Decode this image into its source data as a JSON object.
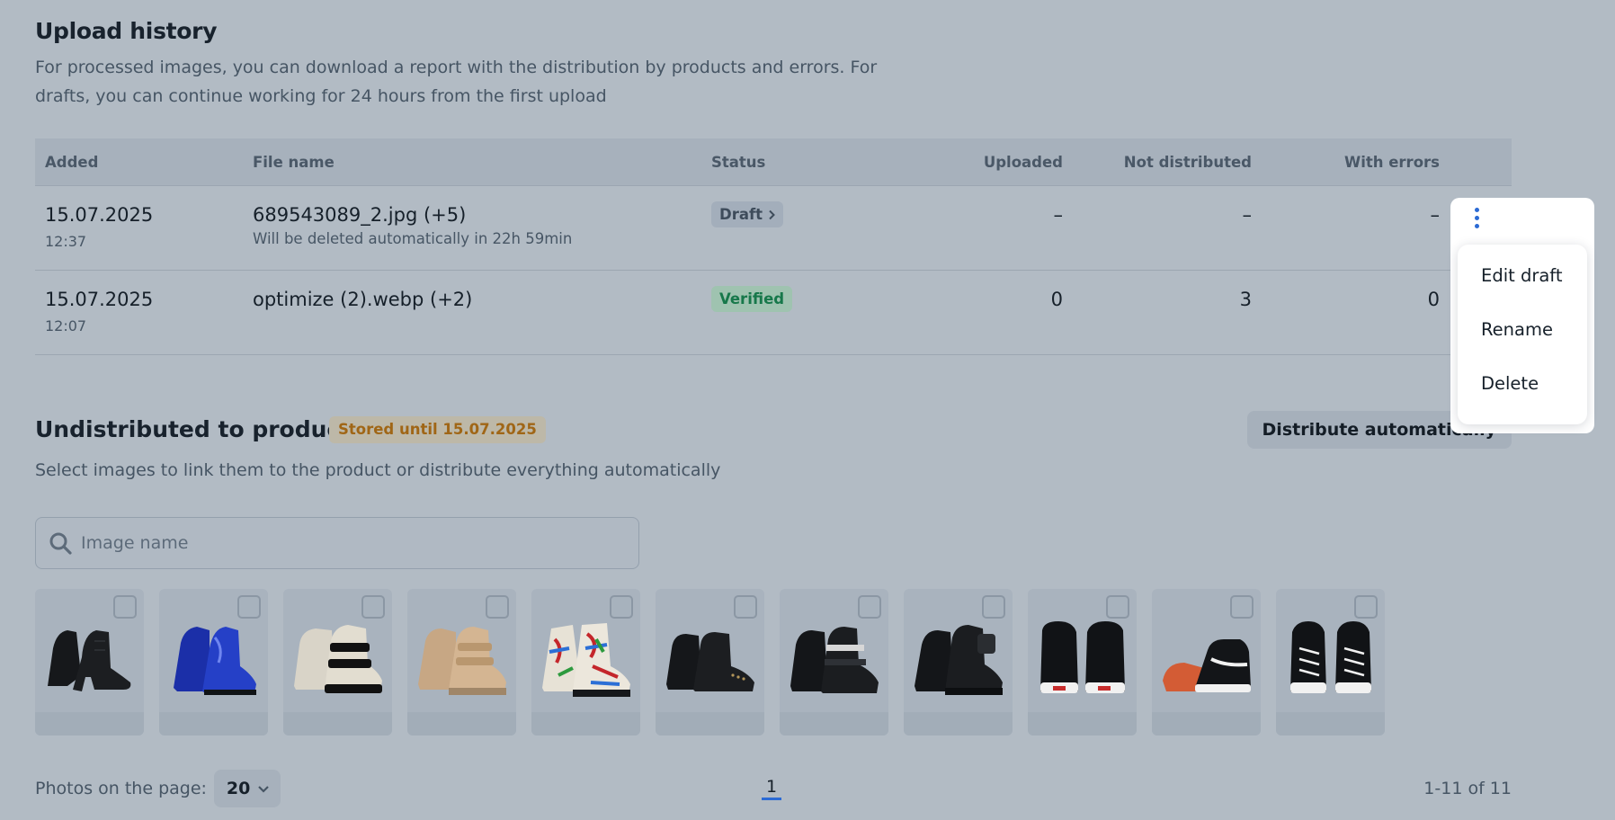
{
  "upload_history": {
    "title": "Upload history",
    "description": "For processed images, you can download a report with the distribution by products and errors. For drafts, you can continue working for 24 hours from the first upload",
    "columns": [
      "Added",
      "File name",
      "Status",
      "Uploaded",
      "Not distributed",
      "With errors"
    ],
    "rows": [
      {
        "date": "15.07.2025",
        "time": "12:37",
        "file": "689543089_2.jpg (+5)",
        "note": "Will be deleted automatically in 22h 59min",
        "status": "Draft",
        "uploaded": "–",
        "not_distributed": "–",
        "with_errors": "–"
      },
      {
        "date": "15.07.2025",
        "time": "12:07",
        "file": "optimize (2).webp (+2)",
        "note": "",
        "status": "Verified",
        "uploaded": "0",
        "not_distributed": "3",
        "with_errors": "0"
      }
    ]
  },
  "context_menu": {
    "items": [
      "Edit draft",
      "Rename",
      "Delete"
    ]
  },
  "undistributed": {
    "title": "Undistributed to products",
    "stored_badge": "Stored until 15.07.2025",
    "auto_button": "Distribute automatically",
    "description": "Select images to link them to the product or distribute everything automatically",
    "search_placeholder": "Image name",
    "images": [
      {
        "icon": "black-stiletto-ankle-boot"
      },
      {
        "icon": "blue-metallic-boot"
      },
      {
        "icon": "black-white-strap-boot"
      },
      {
        "icon": "beige-velcro-boot"
      },
      {
        "icon": "graffiti-print-combat-boot"
      },
      {
        "icon": "black-chelsea-boot"
      },
      {
        "icon": "black-buckle-boot"
      },
      {
        "icon": "black-pouch-combat-boot"
      },
      {
        "icon": "vans-hi-top-pair"
      },
      {
        "icon": "vans-hi-top-side"
      },
      {
        "icon": "vans-hi-top-front"
      }
    ]
  },
  "pagination": {
    "label": "Photos on the page:",
    "per_page": "20",
    "current_page": "1",
    "range": "1-11 of 11"
  },
  "colors": {
    "accent": "#2b6ad4",
    "verified": "#17784a",
    "stored": "#a06616"
  }
}
